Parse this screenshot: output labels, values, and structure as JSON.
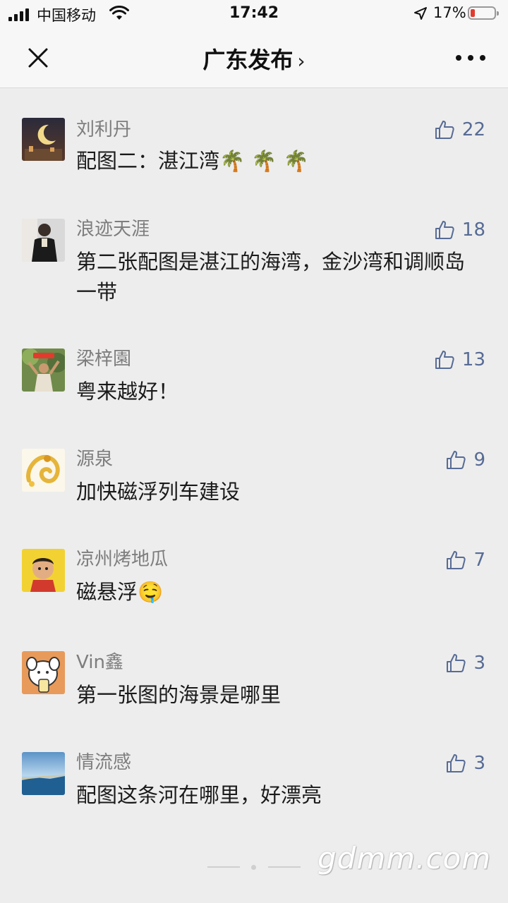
{
  "status_bar": {
    "carrier": "中国移动",
    "time": "17:42",
    "battery": "17%"
  },
  "nav": {
    "title": "广东发布",
    "chevron": "›"
  },
  "comments": [
    {
      "name": "刘利丹",
      "text": "配图二：湛江湾🌴 🌴 🌴",
      "likes": "22"
    },
    {
      "name": "浪迹天涯",
      "text": "第二张配图是湛江的海湾，金沙湾和调顺岛一带",
      "likes": "18"
    },
    {
      "name": "梁梓園",
      "text": "粤来越好！",
      "likes": "13"
    },
    {
      "name": "源泉",
      "text": "加快磁浮列车建设",
      "likes": "9"
    },
    {
      "name": "凉州烤地瓜",
      "text": "磁悬浮🤤",
      "likes": "7"
    },
    {
      "name": "Vin鑫",
      "text": "第一张图的海景是哪里",
      "likes": "3"
    },
    {
      "name": "情流感",
      "text": "配图这条河在哪里，好漂亮",
      "likes": "3"
    }
  ],
  "watermark": "gdmm.com",
  "colors": {
    "link": "#576b95",
    "background": "#ededed",
    "name": "#7d7d7d"
  }
}
